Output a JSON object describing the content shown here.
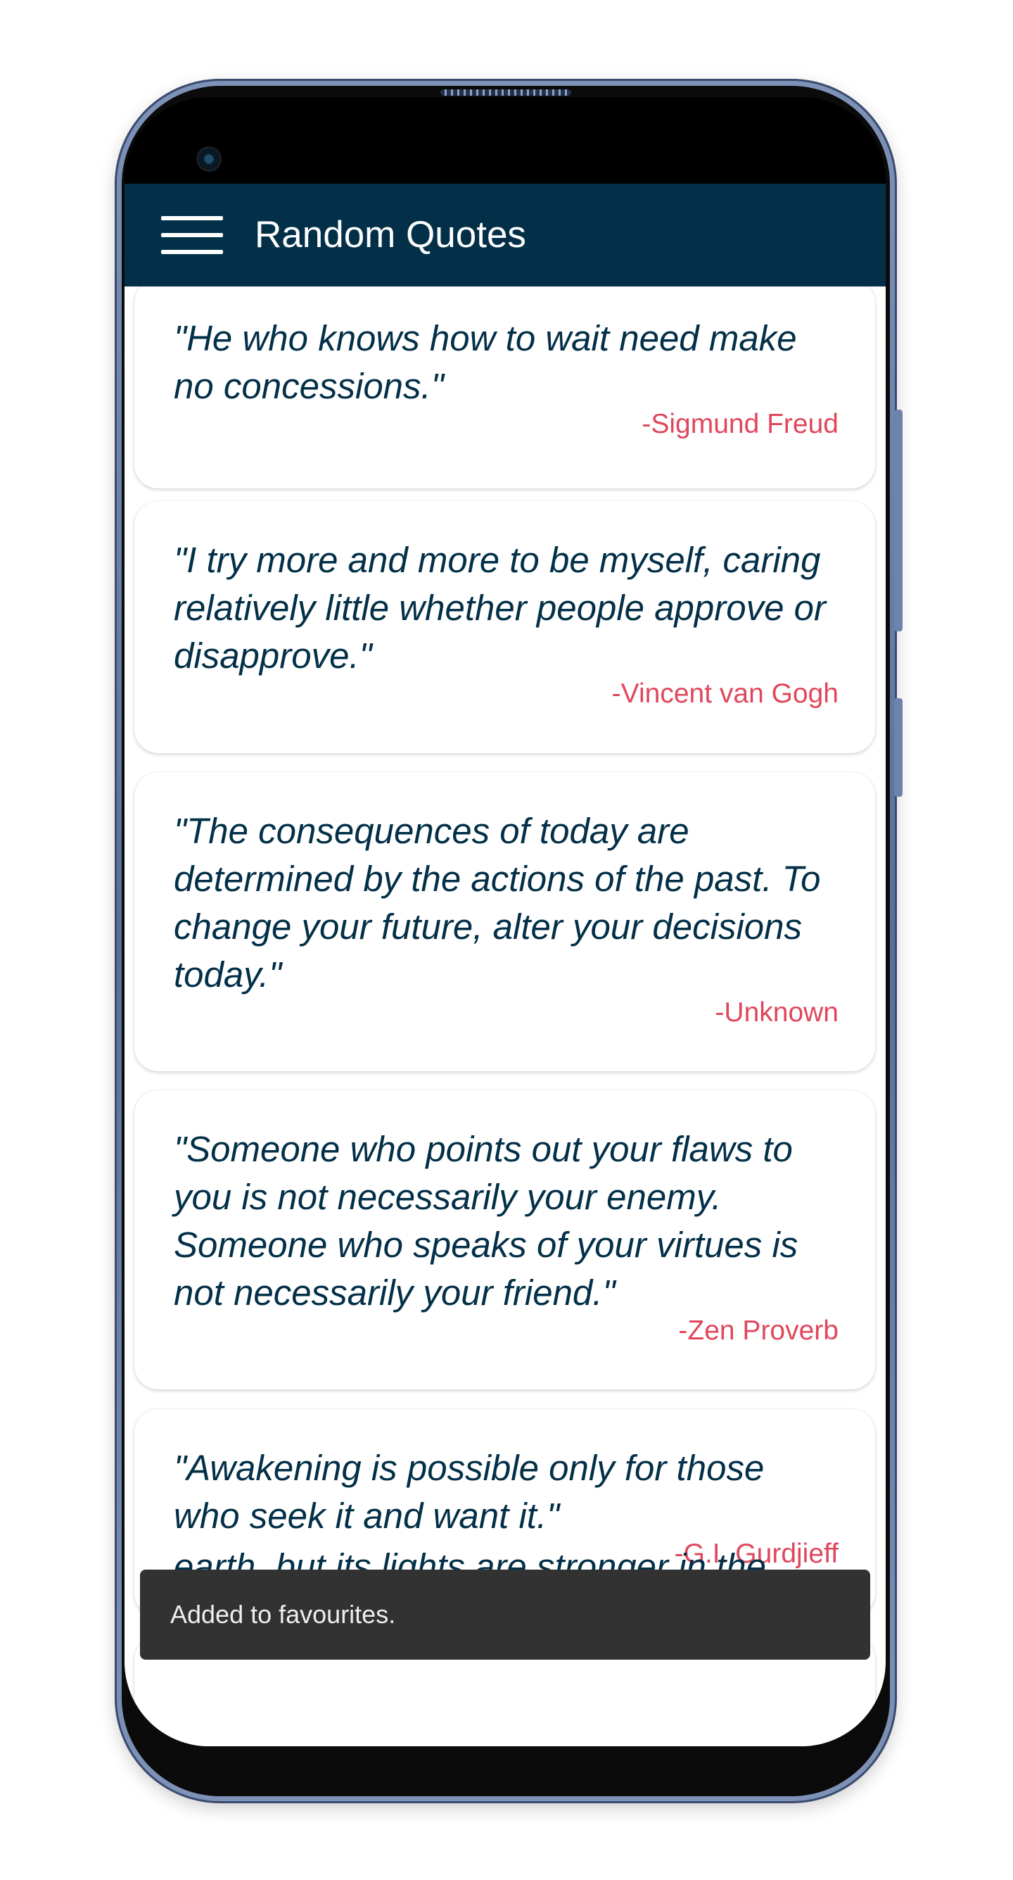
{
  "app": {
    "title": "Random Quotes"
  },
  "quotes": [
    {
      "text": "\"He who knows how to wait need make no concessions.\"",
      "author": "-Sigmund Freud"
    },
    {
      "text": "\"I try more and more to be myself, caring relatively little whether people approve or disapprove.\"",
      "author": "-Vincent van Gogh"
    },
    {
      "text": "\"The consequences of today are determined by the actions of the past. To change your future, alter your decisions today.\"",
      "author": "-Unknown"
    },
    {
      "text": "\"Someone who points out your flaws to you is not necessarily your enemy. Someone who speaks of your virtues is not necessarily your friend.\"",
      "author": "-Zen Proverb"
    },
    {
      "text": "\"Awakening is possible only for those who seek it and want it.\"",
      "author": "-G.I. Gurdjieff"
    }
  ],
  "partial_quote": {
    "text": "earth, but its lights are stronger in the"
  },
  "snackbar": {
    "message": "Added to favourites."
  },
  "colors": {
    "appbar": "#033048",
    "quote_text": "#033048",
    "author_text": "#e0475c",
    "snackbar": "#323232"
  },
  "icons": {
    "menu": "hamburger-menu-icon",
    "camera": "front-camera"
  }
}
